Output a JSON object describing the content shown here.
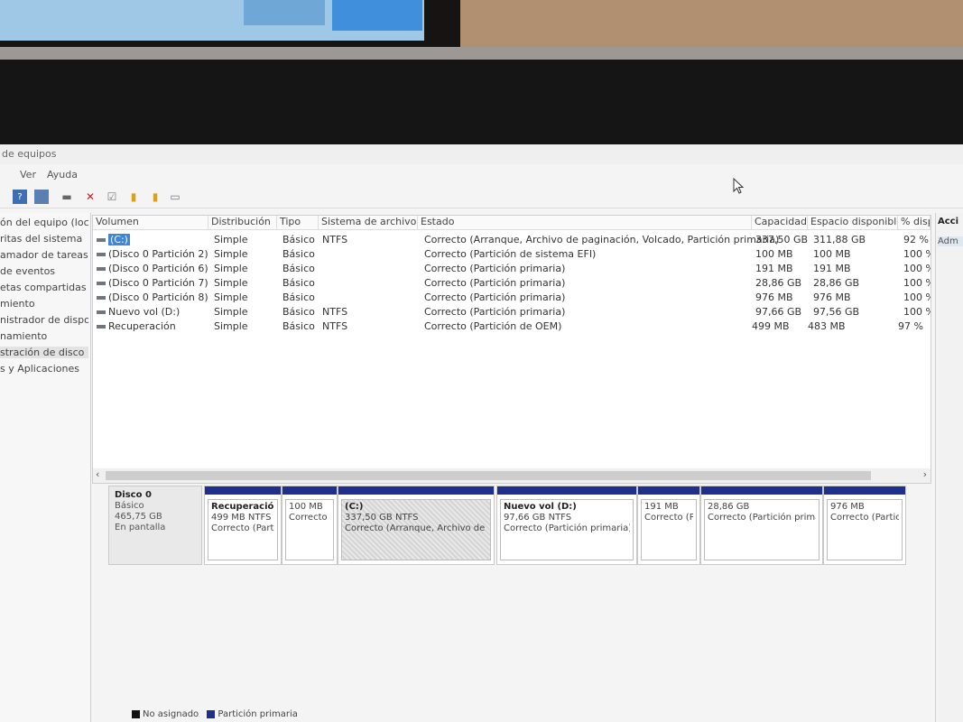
{
  "window": {
    "title": "de equipos"
  },
  "menu": [
    "Ver",
    "Ayuda"
  ],
  "toolbar": {
    "icons": [
      "help-icon",
      "view-icon",
      "disconnect-icon",
      "delete-icon",
      "check-icon",
      "new-icon",
      "folder-icon",
      "properties-icon"
    ]
  },
  "tree": [
    "ón del equipo (loc",
    "ritas del sistema",
    "amador de tareas",
    "de eventos",
    "etas compartidas",
    "miento",
    "nistrador de dispo",
    "namiento",
    "stración de disco",
    "s y Aplicaciones"
  ],
  "columns": [
    "Volumen",
    "Distribución",
    "Tipo",
    "Sistema de archivos",
    "Estado",
    "Capacidad",
    "Espacio disponible",
    "% disp"
  ],
  "volumes": [
    {
      "name": "(C:)",
      "layout": "Simple",
      "type": "Básico",
      "fs": "NTFS",
      "status": "Correcto (Arranque, Archivo de paginación, Volcado, Partición primaria)",
      "capacity": "337,50 GB",
      "free": "311,88 GB",
      "pct": "92 %"
    },
    {
      "name": "(Disco 0 Partición 2)",
      "layout": "Simple",
      "type": "Básico",
      "fs": "",
      "status": "Correcto (Partición de sistema EFI)",
      "capacity": "100 MB",
      "free": "100 MB",
      "pct": "100 %"
    },
    {
      "name": "(Disco 0 Partición 6)",
      "layout": "Simple",
      "type": "Básico",
      "fs": "",
      "status": "Correcto (Partición primaria)",
      "capacity": "191 MB",
      "free": "191 MB",
      "pct": "100 %"
    },
    {
      "name": "(Disco 0 Partición 7)",
      "layout": "Simple",
      "type": "Básico",
      "fs": "",
      "status": "Correcto (Partición primaria)",
      "capacity": "28,86 GB",
      "free": "28,86 GB",
      "pct": "100 %"
    },
    {
      "name": "(Disco 0 Partición 8)",
      "layout": "Simple",
      "type": "Básico",
      "fs": "",
      "status": "Correcto (Partición primaria)",
      "capacity": "976 MB",
      "free": "976 MB",
      "pct": "100 %"
    },
    {
      "name": "Nuevo vol (D:)",
      "layout": "Simple",
      "type": "Básico",
      "fs": "NTFS",
      "status": "Correcto (Partición primaria)",
      "capacity": "97,66 GB",
      "free": "97,56 GB",
      "pct": "100 %"
    },
    {
      "name": "Recuperación",
      "layout": "Simple",
      "type": "Básico",
      "fs": "NTFS",
      "status": "Correcto (Partición de OEM)",
      "capacity": "499 MB",
      "free": "483 MB",
      "pct": "97 %"
    }
  ],
  "disk": {
    "name": "Disco 0",
    "type": "Básico",
    "size": "465,75 GB",
    "state": "En pantalla",
    "partitions": [
      {
        "name": "Recuperación",
        "size": "499 MB NTFS",
        "status": "Correcto (Parti"
      },
      {
        "name": "",
        "size": "100 MB",
        "status": "Correcto ("
      },
      {
        "name": "(C:)",
        "size": "337,50 GB NTFS",
        "status": "Correcto (Arranque, Archivo de p"
      },
      {
        "name": "Nuevo vol (D:)",
        "size": "97,66 GB NTFS",
        "status": "Correcto (Partición primaria)"
      },
      {
        "name": "",
        "size": "191 MB",
        "status": "Correcto (Pa"
      },
      {
        "name": "",
        "size": "28,86 GB",
        "status": "Correcto (Partición primar"
      },
      {
        "name": "",
        "size": "976 MB",
        "status": "Correcto (Partició"
      }
    ]
  },
  "legend": [
    "No asignado",
    "Partición primaria"
  ],
  "actions": {
    "header": "Acci",
    "item": "Adm"
  }
}
